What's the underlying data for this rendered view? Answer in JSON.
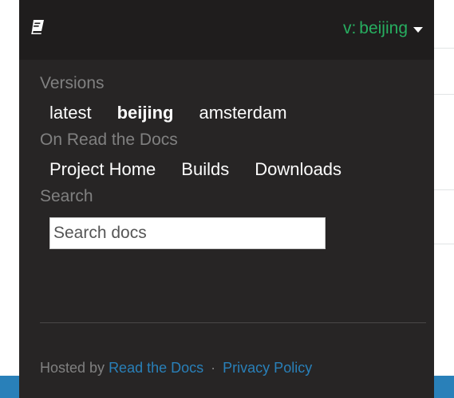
{
  "header": {
    "icon": "book-icon",
    "version_prefix": "v:",
    "current_version": "beijing"
  },
  "versions": {
    "title": "Versions",
    "items": [
      {
        "label": "latest",
        "active": false
      },
      {
        "label": "beijing",
        "active": true
      },
      {
        "label": "amsterdam",
        "active": false
      }
    ]
  },
  "rtd": {
    "title": "On Read the Docs",
    "items": [
      {
        "label": "Project Home"
      },
      {
        "label": "Builds"
      },
      {
        "label": "Downloads"
      }
    ]
  },
  "search": {
    "title": "Search",
    "placeholder": "Search docs"
  },
  "footer": {
    "hosted_by": "Hosted by",
    "rtd_link": "Read the Docs",
    "separator": "·",
    "privacy_link": "Privacy Policy"
  },
  "colors": {
    "panel_bg": "#272525",
    "header_bg": "#1f1d1d",
    "version_green": "#27ae60",
    "link_blue": "#2980b9",
    "muted_text": "#808080"
  }
}
